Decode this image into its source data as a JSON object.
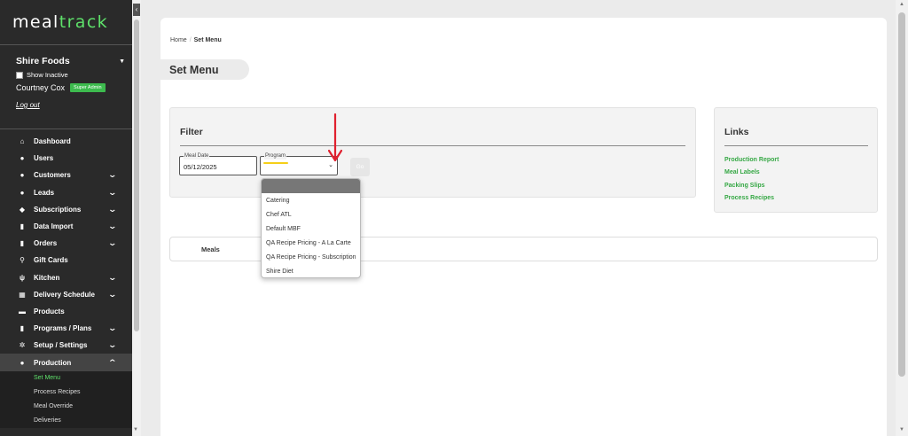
{
  "sidebar": {
    "logo_meal": "meal",
    "logo_track": "track",
    "org_name": "Shire Foods",
    "show_inactive": "Show Inactive",
    "user_name": "Courtney Cox",
    "user_badge": "Super Admin",
    "logout": "Log out",
    "items": [
      {
        "label": "Dashboard",
        "icon": "home-icon",
        "glyph": "⌂",
        "chevron": ""
      },
      {
        "label": "Users",
        "icon": "user-icon",
        "glyph": "●",
        "chevron": ""
      },
      {
        "label": "Customers",
        "icon": "users-icon",
        "glyph": "●",
        "chevron": "⌄"
      },
      {
        "label": "Leads",
        "icon": "info-icon",
        "glyph": "●",
        "chevron": "⌄"
      },
      {
        "label": "Subscriptions",
        "icon": "layers-icon",
        "glyph": "◆",
        "chevron": "⌄"
      },
      {
        "label": "Data Import",
        "icon": "file-icon",
        "glyph": "▮",
        "chevron": "⌄"
      },
      {
        "label": "Orders",
        "icon": "bag-icon",
        "glyph": "▮",
        "chevron": "⌄"
      },
      {
        "label": "Gift Cards",
        "icon": "wrench-icon",
        "glyph": "⚲",
        "chevron": ""
      },
      {
        "label": "Kitchen",
        "icon": "utensils-icon",
        "glyph": "ψ",
        "chevron": "⌄"
      },
      {
        "label": "Delivery Schedule",
        "icon": "calendar-icon",
        "glyph": "▦",
        "chevron": "⌄"
      },
      {
        "label": "Products",
        "icon": "box-icon",
        "glyph": "▬",
        "chevron": ""
      },
      {
        "label": "Programs / Plans",
        "icon": "clipboard-icon",
        "glyph": "▮",
        "chevron": "⌄"
      },
      {
        "label": "Setup / Settings",
        "icon": "gear-icon",
        "glyph": "✲",
        "chevron": "⌄"
      },
      {
        "label": "Production",
        "icon": "user-icon",
        "glyph": "●",
        "chevron": "⌃"
      }
    ],
    "sub_items": [
      "Set Menu",
      "Process Recipes",
      "Meal Override",
      "Deliveries"
    ]
  },
  "breadcrumb": {
    "home": "Home",
    "current": "Set Menu"
  },
  "page_title": "Set Menu",
  "filter": {
    "title": "Filter",
    "meal_date_label": "Meal Date",
    "meal_date_value": "05/12/2025",
    "program_label": "Program",
    "program_value": "",
    "go_label": "Go"
  },
  "links": {
    "title": "Links",
    "items": [
      "Production Report",
      "Meal Labels",
      "Packing Slips",
      "Process Recipes"
    ]
  },
  "tabs": {
    "meals": "Meals"
  },
  "program_options": [
    "",
    "Catering",
    "Chef ATL",
    "Default MBF",
    "QA Recipe Pricing - A La Carte",
    "QA Recipe Pricing - Subscription",
    "Shire Diet"
  ],
  "colors": {
    "accent_green": "#36a845",
    "sidebar_bg": "#2a2a2a",
    "annotation_red": "#e0202e",
    "highlight_yellow": "#f5cf18"
  }
}
